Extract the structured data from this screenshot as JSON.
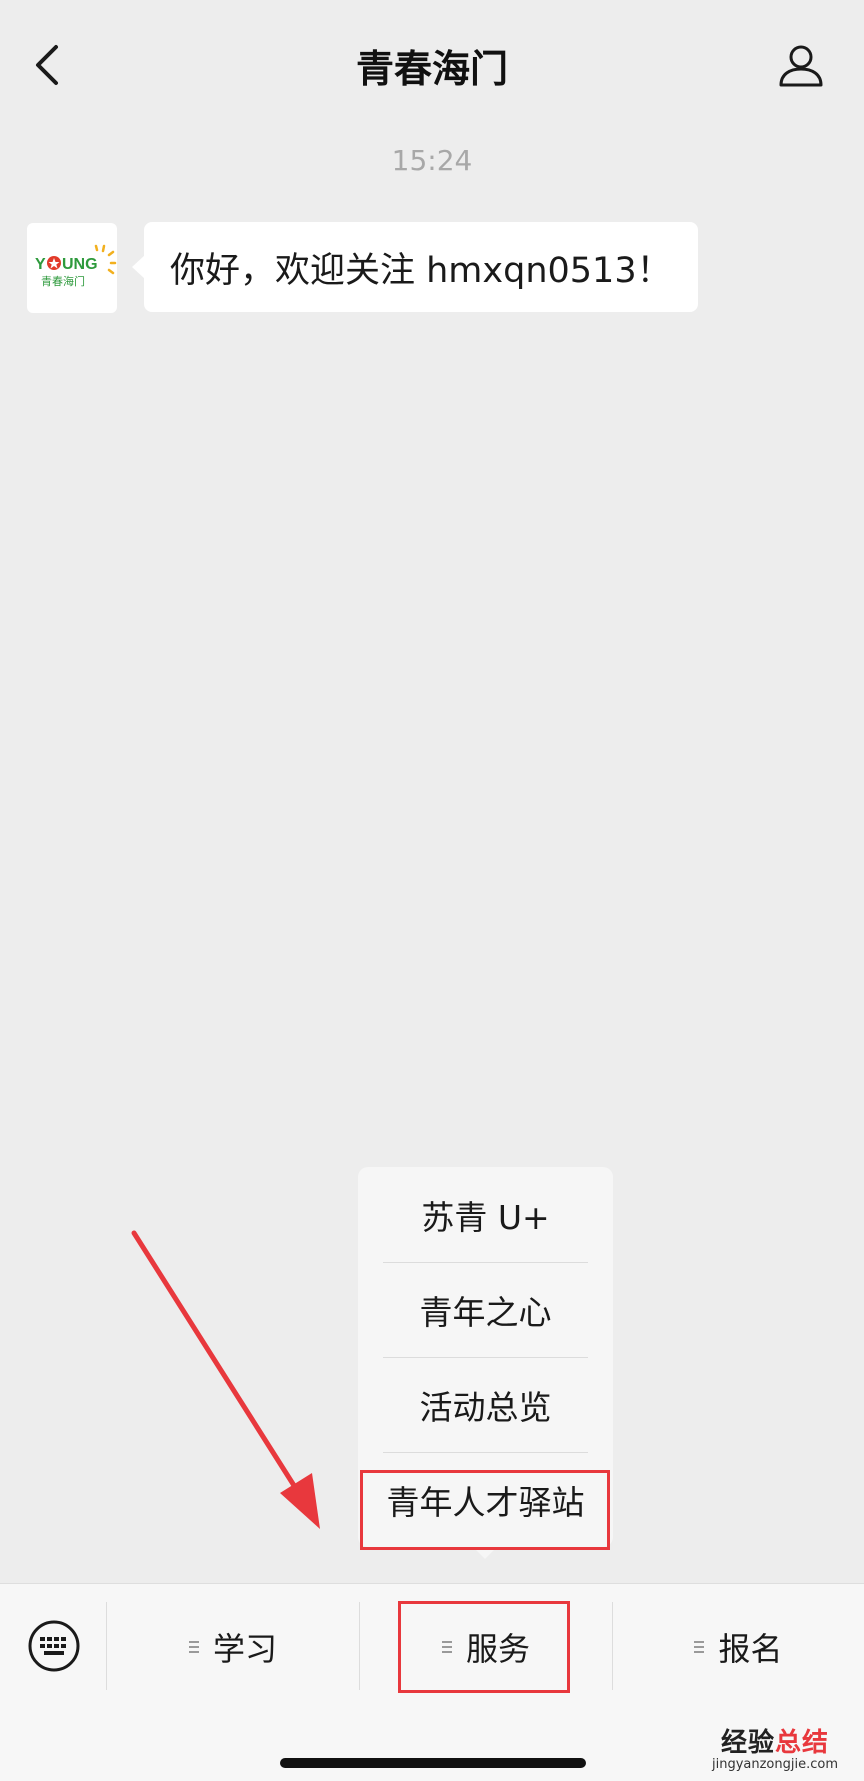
{
  "header": {
    "title": "青春海门",
    "back_icon": "chevron-left-icon",
    "profile_icon": "person-icon"
  },
  "chat": {
    "timestamp": "15:24",
    "avatar": {
      "logo_text": "YOUNG",
      "logo_subtext": "青春海门",
      "colors": {
        "green": "#2e9a3c",
        "red": "#e23b2a",
        "yellow": "#f2b01e"
      }
    },
    "message": "你好，欢迎关注 hmxqn0513！"
  },
  "submenu": {
    "items": [
      {
        "label": "苏青 U+"
      },
      {
        "label": "青年之心"
      },
      {
        "label": "活动总览"
      },
      {
        "label": "青年人才驿站"
      }
    ]
  },
  "bottom_bar": {
    "keyboard_icon": "keyboard-icon",
    "items": [
      {
        "label": "学习"
      },
      {
        "label": "服务"
      },
      {
        "label": "报名"
      }
    ]
  },
  "watermark": {
    "cn_a": "经验",
    "cn_b": "总结",
    "en": "jingyanzongjie.com"
  },
  "colors": {
    "background": "#ededed",
    "highlight": "#e8383d",
    "bubble": "#ffffff"
  }
}
